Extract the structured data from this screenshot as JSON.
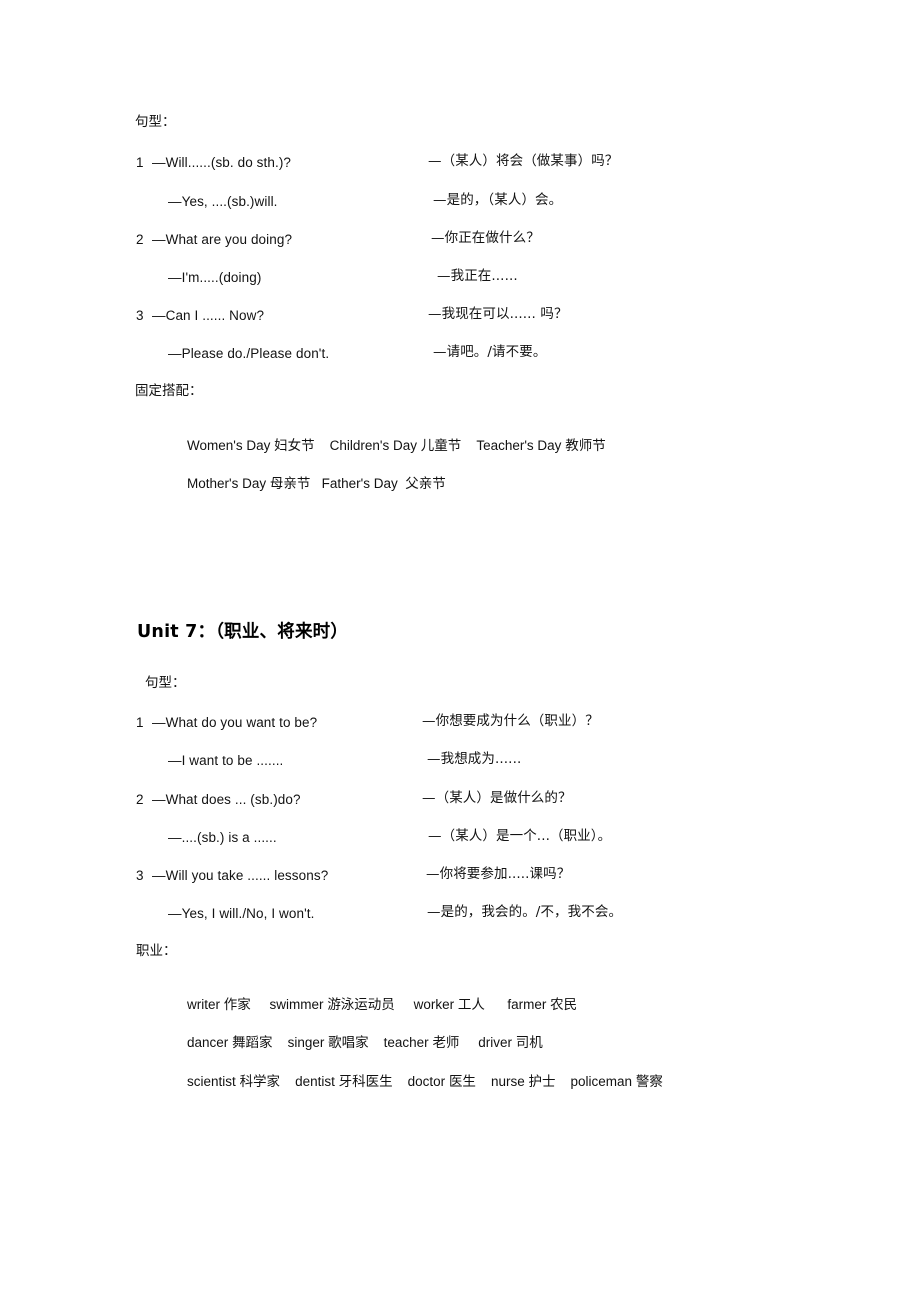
{
  "document": {
    "language_note": "Chinese-English primary school English review notes",
    "sections": [
      {
        "id": "unit6-tail",
        "patterns_label": "句型：",
        "patterns": [
          {
            "num": "1",
            "en": "—Will......(sb. do sth.)?",
            "zh": "—（某人）将会（做某事）吗？"
          },
          {
            "num": "",
            "en": "—Yes, ....(sb.)will.",
            "zh": "—是的，（某人）会。"
          },
          {
            "num": "2",
            "en": "—What are you doing?",
            "zh": "—你正在做什么？"
          },
          {
            "num": "",
            "en": "—I'm.....(doing)",
            "zh": "—我正在......"
          },
          {
            "num": "3",
            "en": "—Can I ...... Now?",
            "zh": "—我现在可以...... 吗？"
          },
          {
            "num": "",
            "en": "—Please do./Please don't.",
            "zh": "—请吧。/请不要。"
          }
        ],
        "collocations_label": "固定搭配：",
        "collocations": [
          [
            {
              "en": "Women's Day",
              "zh": "妇女节"
            },
            {
              "en": "Children's Day",
              "zh": "儿童节"
            },
            {
              "en": "Teacher's Day",
              "zh": "教师节"
            }
          ],
          [
            {
              "en": "Mother's Day",
              "zh": "母亲节"
            },
            {
              "en": "Father's Day",
              "zh": "父亲节"
            }
          ]
        ]
      },
      {
        "id": "unit7",
        "heading": "Unit 7：（职业、将来时）",
        "patterns_label": "句型：",
        "patterns": [
          {
            "num": "1",
            "en": "—What do you want to be?",
            "zh": "—你想要成为什么（职业）？"
          },
          {
            "num": "",
            "en": "—I want to be .......",
            "zh": "—我想成为......"
          },
          {
            "num": "2",
            "en": "—What does ... (sb.)do?",
            "zh": "—（某人）是做什么的？"
          },
          {
            "num": "",
            "en": "—....(sb.) is a ......",
            "zh": "—（某人）是一个...（职业）。"
          },
          {
            "num": "3",
            "en": "—Will you take ...... lessons?",
            "zh": "—你将要参加.....课吗？"
          },
          {
            "num": "",
            "en": "—Yes, I will./No, I won't.",
            "zh": "—是的，我会的。/不，我不会。"
          }
        ],
        "vocab_label": "职业：",
        "vocab_rows": [
          [
            {
              "en": "writer",
              "zh": "作家"
            },
            {
              "en": "swimmer",
              "zh": "游泳运动员"
            },
            {
              "en": "worker",
              "zh": "工人"
            },
            {
              "en": "farmer",
              "zh": "农民"
            }
          ],
          [
            {
              "en": "dancer",
              "zh": "舞蹈家"
            },
            {
              "en": "singer",
              "zh": "歌唱家"
            },
            {
              "en": "teacher",
              "zh": "老师"
            },
            {
              "en": "driver",
              "zh": "司机"
            }
          ],
          [
            {
              "en": "scientist",
              "zh": "科学家"
            },
            {
              "en": "dentist",
              "zh": "牙科医生"
            },
            {
              "en": "doctor",
              "zh": "医生"
            },
            {
              "en": "nurse",
              "zh": "护士"
            },
            {
              "en": "policeman",
              "zh": "警察"
            }
          ]
        ]
      }
    ]
  },
  "u6": {
    "patterns_label": "句型：",
    "p1n": "1",
    "p1e": "—Will......(sb. do sth.)?",
    "p1z": "—（某人）将会（做某事）吗？",
    "p2n": "",
    "p2e": "—Yes, ....(sb.)will.",
    "p2z": "—是的，（某人）会。",
    "p3n": "2",
    "p3e": "—What are you doing?",
    "p3z": "—你正在做什么？",
    "p4n": "",
    "p4e": "—I'm.....(doing)",
    "p4z": "—我正在......",
    "p5n": "3",
    "p5e": "—Can I ...... Now?",
    "p5z": "—我现在可以...... 吗？",
    "p6n": "",
    "p6e": "—Please do./Please don't.",
    "p6z": "—请吧。/请不要。",
    "colloc_label": "固定搭配：",
    "c1a_en": "Women's Day",
    "c1a_zh": "妇女节",
    "c1b_en": "Children's Day",
    "c1b_zh": "儿童节",
    "c1c_en": "Teacher's Day",
    "c1c_zh": "教师节",
    "c2a_en": "Mother's Day",
    "c2a_zh": "母亲节",
    "c2b_en": "Father's Day",
    "c2b_zh": "父亲节"
  },
  "u7": {
    "heading": "Unit 7：（职业、将来时）",
    "patterns_label": "句型：",
    "p1n": "1",
    "p1e": "—What do you want to be?",
    "p1z": "—你想要成为什么（职业）？",
    "p2n": "",
    "p2e": "—I want to be .......",
    "p2z": "—我想成为......",
    "p3n": "2",
    "p3e": "—What does ... (sb.)do?",
    "p3z": "—（某人）是做什么的？",
    "p4n": "",
    "p4e": "—....(sb.) is a ......",
    "p4z": "—（某人）是一个...（职业）。",
    "p5n": "3",
    "p5e": "—Will you take ...... lessons?",
    "p5z": "—你将要参加.....课吗？",
    "p6n": "",
    "p6e": "—Yes, I will./No, I won't.",
    "p6z": "—是的，我会的。/不，我不会。",
    "vocab_label": "职业：",
    "v1a_en": "writer",
    "v1a_zh": "作家",
    "v1b_en": "swimmer",
    "v1b_zh": "游泳运动员",
    "v1c_en": "worker",
    "v1c_zh": "工人",
    "v1d_en": "farmer",
    "v1d_zh": "农民",
    "v2a_en": "dancer",
    "v2a_zh": "舞蹈家",
    "v2b_en": "singer",
    "v2b_zh": "歌唱家",
    "v2c_en": "teacher",
    "v2c_zh": "老师",
    "v2d_en": "driver",
    "v2d_zh": "司机",
    "v3a_en": "scientist",
    "v3a_zh": "科学家",
    "v3b_en": "dentist",
    "v3b_zh": "牙科医生",
    "v3c_en": "doctor",
    "v3c_zh": "医生",
    "v3d_en": "nurse",
    "v3d_zh": "护士",
    "v3e_en": "policeman",
    "v3e_zh": "警察"
  }
}
